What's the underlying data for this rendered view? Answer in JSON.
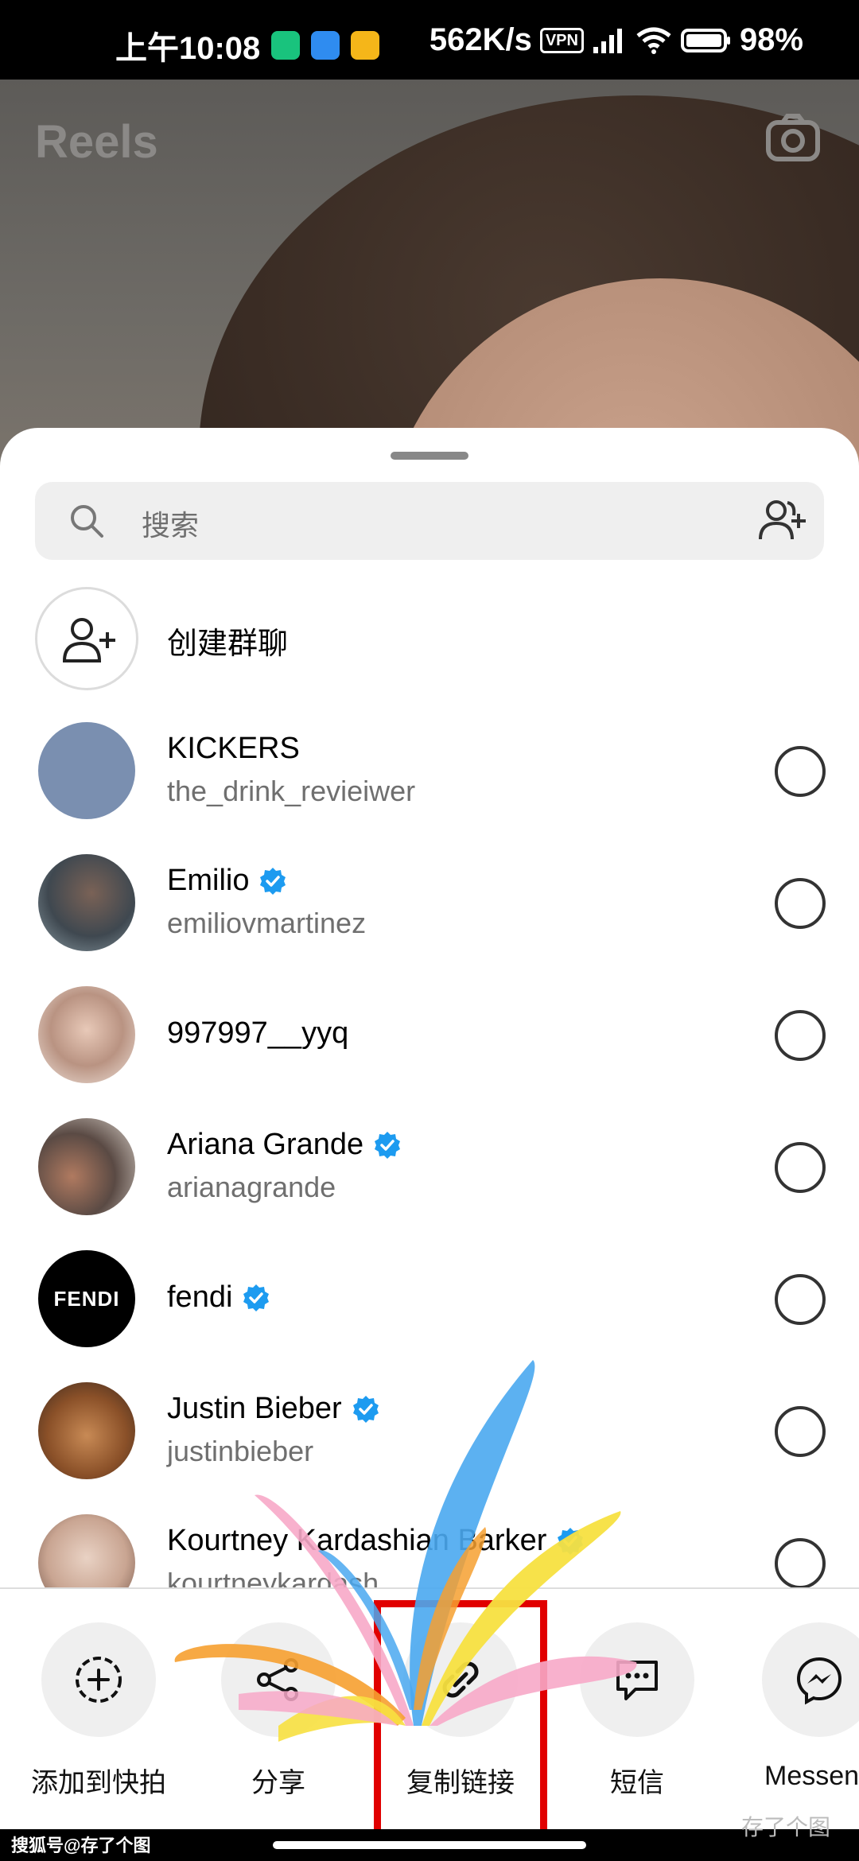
{
  "status_bar": {
    "time": "上午10:08",
    "speed": "562K/s",
    "vpn": "VPN",
    "battery": "98%"
  },
  "background": {
    "title": "Reels"
  },
  "search": {
    "placeholder": "搜索"
  },
  "create_group": {
    "label": "创建群聊"
  },
  "contacts": [
    {
      "name": "KICKERS",
      "username": "the_drink_revieiwer",
      "verified": false
    },
    {
      "name": "Emilio",
      "username": "emiliovmartinez",
      "verified": true
    },
    {
      "name": "997997__yyq",
      "username": "",
      "verified": false
    },
    {
      "name": "Ariana Grande",
      "username": "arianagrande",
      "verified": true
    },
    {
      "name": "fendi",
      "username": "",
      "verified": true,
      "avatar_text": "FENDI"
    },
    {
      "name": "Justin Bieber",
      "username": "justinbieber",
      "verified": true
    },
    {
      "name": "Kourtney Kardashian Barker",
      "username": "kourtneykardash",
      "verified": true
    }
  ],
  "actions": [
    {
      "label": "添加到快拍",
      "icon": "add-story-icon"
    },
    {
      "label": "分享",
      "icon": "share-icon"
    },
    {
      "label": "复制链接",
      "icon": "link-icon"
    },
    {
      "label": "短信",
      "icon": "sms-icon"
    },
    {
      "label": "Messeng",
      "icon": "messenger-icon"
    }
  ],
  "watermarks": {
    "left": "搜狐号@存了个图",
    "right": "存了个图"
  },
  "colors": {
    "accent_blue": "#1d9bf0",
    "highlight_red": "#e10000"
  }
}
